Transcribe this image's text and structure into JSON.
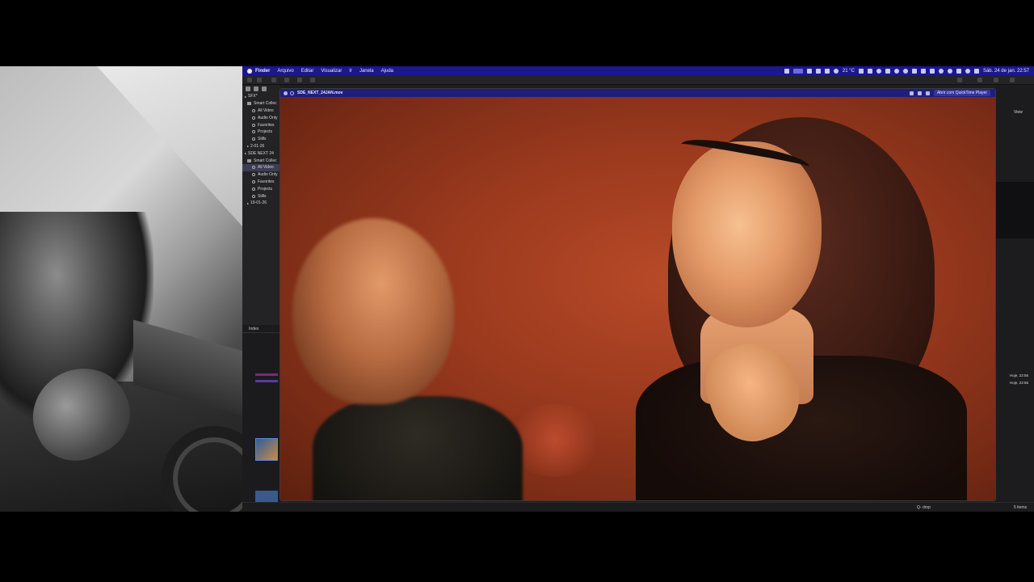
{
  "menubar": {
    "app": "Finder",
    "items": [
      "Arquivo",
      "Editar",
      "Visualizar",
      "Ir",
      "Janela",
      "Ajuda"
    ],
    "temperature": "21 °C",
    "datetime": "Sáb. 24 de jan.  22:57"
  },
  "sidebar": {
    "items": [
      {
        "label": "SFX*",
        "level": 0,
        "kind": "library"
      },
      {
        "label": "Smart Collec",
        "level": 1,
        "kind": "folder"
      },
      {
        "label": "All Video",
        "level": 2,
        "kind": "smart"
      },
      {
        "label": "Audio Only",
        "level": 2,
        "kind": "smart"
      },
      {
        "label": "Favorites",
        "level": 2,
        "kind": "smart"
      },
      {
        "label": "Projects",
        "level": 2,
        "kind": "smart"
      },
      {
        "label": "Stills",
        "level": 2,
        "kind": "smart"
      },
      {
        "label": "2-01-26",
        "level": 1,
        "kind": "event"
      },
      {
        "label": "SDE NEXT 24",
        "level": 0,
        "kind": "library"
      },
      {
        "label": "Smart Collec",
        "level": 1,
        "kind": "folder"
      },
      {
        "label": "All Video",
        "level": 2,
        "kind": "smart",
        "selected": true
      },
      {
        "label": "Audio Only",
        "level": 2,
        "kind": "smart"
      },
      {
        "label": "Favorites",
        "level": 2,
        "kind": "smart"
      },
      {
        "label": "Projects",
        "level": 2,
        "kind": "smart"
      },
      {
        "label": "Stills",
        "level": 2,
        "kind": "smart"
      },
      {
        "label": "19-01-26",
        "level": 1,
        "kind": "event"
      }
    ]
  },
  "index_panel": {
    "title": "Index"
  },
  "quicklook": {
    "filename": "SDE_NEXT_24JAN.mov",
    "open_with": "Abrir com QuickTime Player"
  },
  "finder_right": {
    "view_label": "View",
    "dates": [
      "Hoje, 22:56",
      "Hoje, 22:56"
    ]
  },
  "bottombar": {
    "search": "Q- drop",
    "items_count": "5 items"
  }
}
